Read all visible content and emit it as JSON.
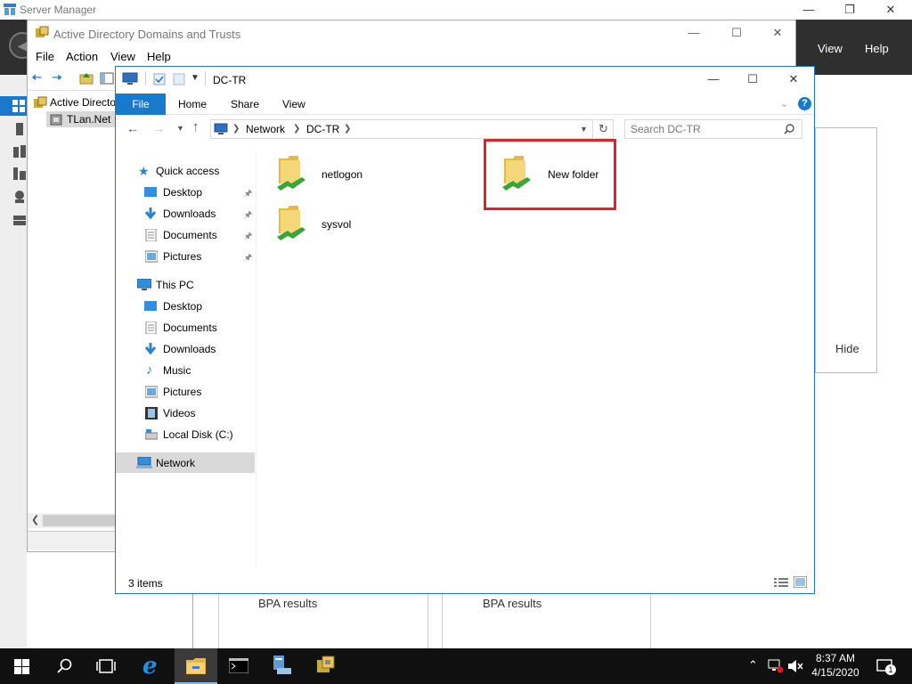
{
  "server_manager": {
    "title": "Server Manager",
    "menu": {
      "view": "View",
      "help": "Help"
    },
    "hide_label": "Hide",
    "bpa_results": [
      "BPA results",
      "BPA results"
    ]
  },
  "ad_window": {
    "title": "Active Directory Domains and Trusts",
    "menu": [
      "File",
      "Action",
      "View",
      "Help"
    ],
    "tree": {
      "root": "Active Directory Domains and Trusts",
      "domain": "TLan.Net"
    }
  },
  "explorer": {
    "title": "DC-TR",
    "tabs": {
      "file": "File",
      "home": "Home",
      "share": "Share",
      "view": "View"
    },
    "breadcrumb": [
      "Network",
      "DC-TR"
    ],
    "search_placeholder": "Search DC-TR",
    "nav": {
      "quick_access": "Quick access",
      "quick_items": [
        "Desktop",
        "Downloads",
        "Documents",
        "Pictures"
      ],
      "this_pc": "This PC",
      "pc_items": [
        "Desktop",
        "Documents",
        "Downloads",
        "Music",
        "Pictures",
        "Videos",
        "Local Disk (C:)"
      ],
      "network": "Network"
    },
    "items": [
      "netlogon",
      "New folder",
      "sysvol"
    ],
    "status": "3 items"
  },
  "taskbar": {
    "time": "8:37 AM",
    "date": "4/15/2020",
    "notification_count": "1"
  },
  "colors": {
    "accent": "#1979ca",
    "highlight_box": "#d9262e",
    "taskbar": "#101010"
  }
}
